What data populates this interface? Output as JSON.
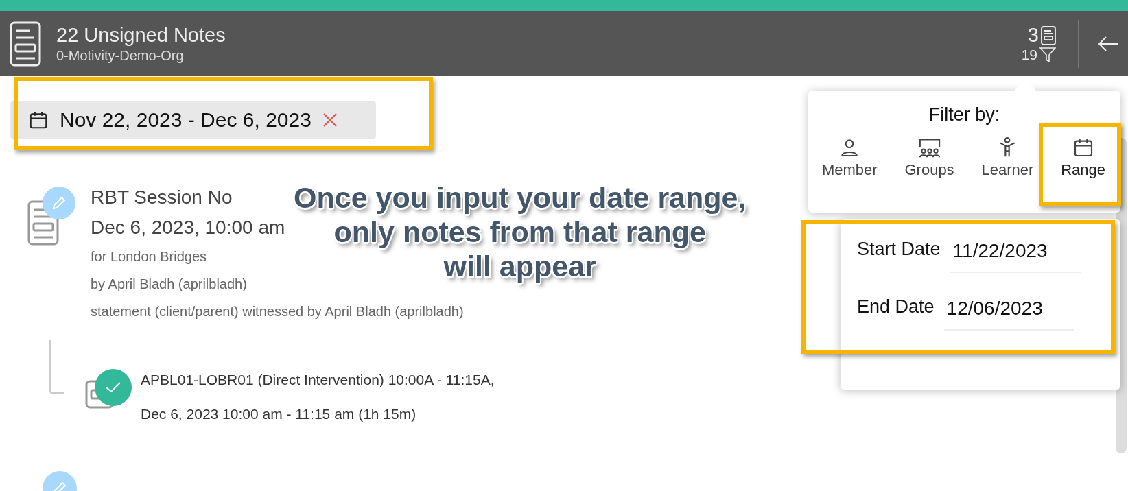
{
  "header": {
    "title": "22 Unsigned Notes",
    "subtitle": "0-Motivity-Demo-Org",
    "unsigned_count": "3",
    "filter_count": "19"
  },
  "date_filter": {
    "label": "Nov 22, 2023 - Dec 6, 2023"
  },
  "notes": [
    {
      "signed": false,
      "title": "RBT Session No",
      "time": "Dec 6, 2023, 10:00 am",
      "lines": [
        "for London Bridges",
        "by April Bladh (aprilbladh)",
        "statement (client/parent) witnessed by April Bladh (aprilbladh)"
      ],
      "children": [
        {
          "signed": true,
          "title": "APBL01-LOBR01 (Direct Intervention) 10:00A - 11:15A,",
          "time": "Dec 6, 2023 10:00 am - 11:15 am (1h 15m)"
        }
      ]
    },
    {
      "signed": false
    }
  ],
  "filter_popup": {
    "title": "Filter by:",
    "options": [
      {
        "kind": "member",
        "label": "Member",
        "selected": false
      },
      {
        "kind": "groups",
        "label": "Groups",
        "selected": false
      },
      {
        "kind": "learner",
        "label": "Learner",
        "selected": false
      },
      {
        "kind": "range",
        "label": "Range",
        "selected": true
      }
    ]
  },
  "range": {
    "fields": [
      {
        "label": "Start Date",
        "value": "11/22/2023"
      },
      {
        "label": "End Date",
        "value": "12/06/2023"
      }
    ]
  },
  "annotation": {
    "caption": [
      "Once you input your date range,",
      "only notes from that range",
      "will appear"
    ]
  }
}
